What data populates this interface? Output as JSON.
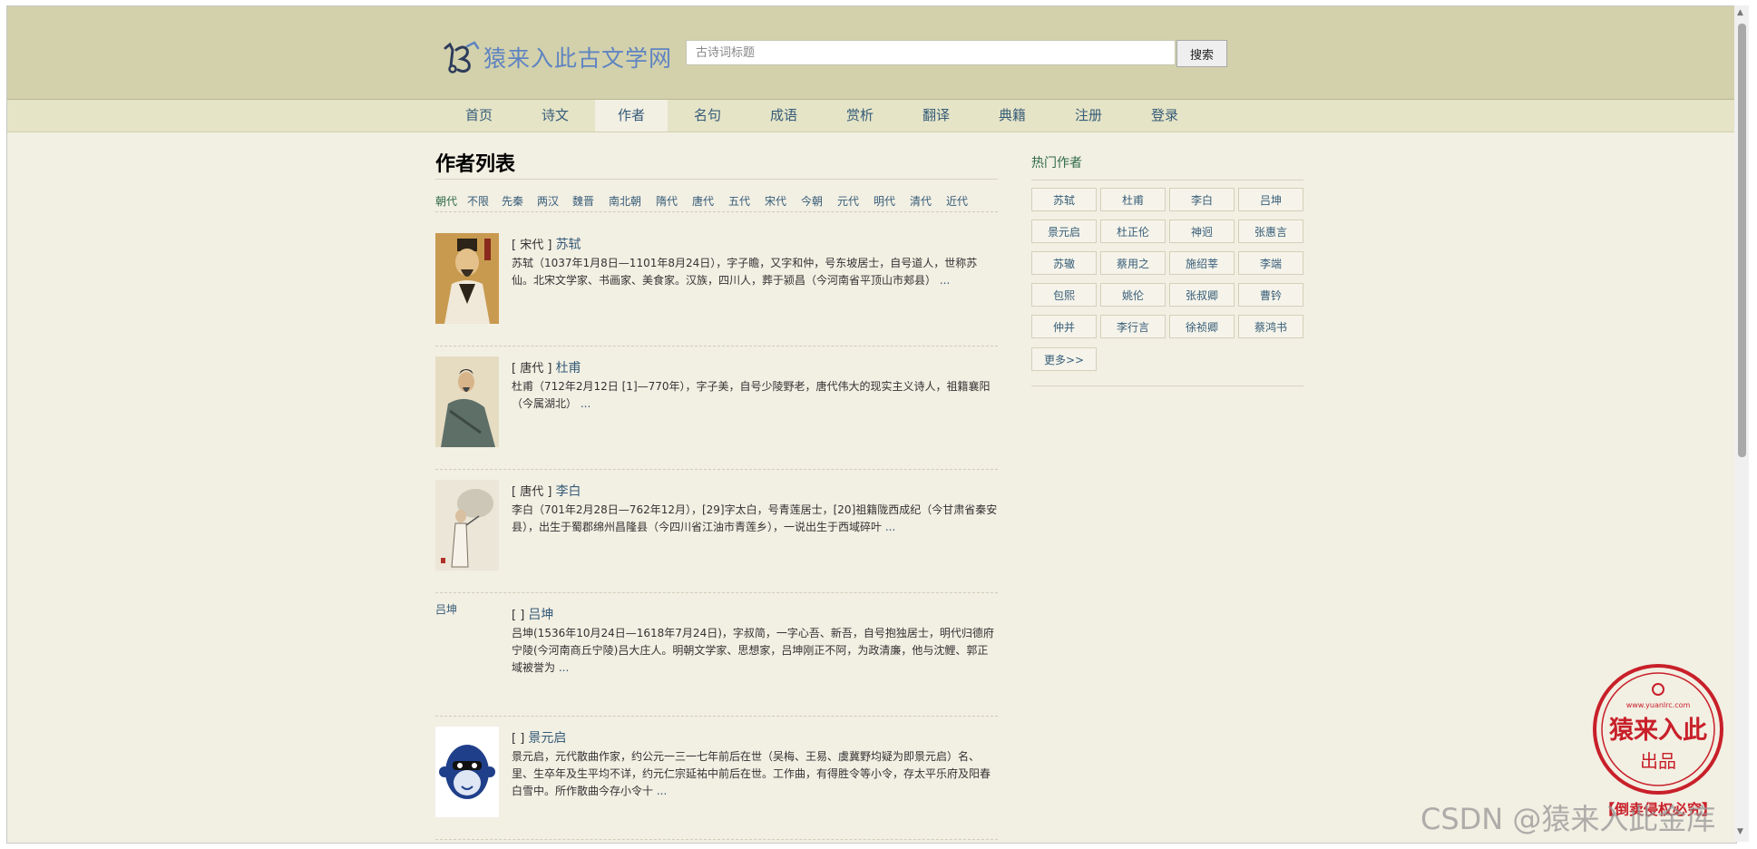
{
  "site": {
    "logo_text": "猿来入此古文学网"
  },
  "search": {
    "placeholder": "古诗词标题",
    "button": "搜索"
  },
  "nav": [
    "首页",
    "诗文",
    "作者",
    "名句",
    "成语",
    "赏析",
    "翻译",
    "典籍",
    "注册",
    "登录"
  ],
  "nav_active": 2,
  "page_title": "作者列表",
  "dynasties": [
    "朝代",
    "不限",
    "先秦",
    "两汉",
    "魏晋",
    "南北朝",
    "隋代",
    "唐代",
    "五代",
    "宋代",
    "今朝",
    "元代",
    "明代",
    "清代",
    "近代"
  ],
  "authors": [
    {
      "dynasty": "[ 宋代 ]",
      "name": "苏轼",
      "bio": "苏轼（1037年1月8日—1101年8月24日），字子瞻，又字和仲，号东坡居士，自号道人，世称苏仙。北宋文学家、书画家、美食家。汉族，四川人，葬于颍昌（今河南省平顶山市郏县）",
      "more": "..."
    },
    {
      "dynasty": "[ 唐代 ]",
      "name": "杜甫",
      "bio": "杜甫（712年2月12日 [1]—770年），字子美，自号少陵野老，唐代伟大的现实主义诗人，祖籍襄阳（今属湖北）",
      "more": "..."
    },
    {
      "dynasty": "[ 唐代 ]",
      "name": "李白",
      "bio": "李白（701年2月28日—762年12月），[29]字太白，号青莲居士，[20]祖籍陇西成纪（今甘肃省秦安县），出生于蜀郡绵州昌隆县（今四川省江油市青莲乡），一说出生于西域碎叶",
      "more": "..."
    },
    {
      "dynasty": "[ ]",
      "name": "吕坤",
      "img_alt": "吕坤",
      "bio": "吕坤(1536年10月24日—1618年7月24日)，字叔简，一字心吾、新吾，自号抱独居士，明代归德府宁陵(今河南商丘宁陵)吕大庄人。明朝文学家、思想家，吕坤刚正不阿，为政清廉，他与沈鲤、郭正域被誉为",
      "more": "..."
    },
    {
      "dynasty": "[ ]",
      "name": "景元启",
      "bio": "景元启，元代散曲作家，约公元一三一七年前后在世（吴梅、王易、虞冀野均疑为即景元启）名、里、生卒年及生平均不详，约元仁宗延祐中前后在世。工作曲，有得胜令等小令，存太平乐府及阳春白雪中。所作散曲今存小令十",
      "more": "..."
    }
  ],
  "hot": {
    "title": "热门作者",
    "items": [
      "苏轼",
      "杜甫",
      "李白",
      "吕坤",
      "景元启",
      "杜正伦",
      "神迥",
      "张惠言",
      "苏辙",
      "蔡用之",
      "施绍莘",
      "李端",
      "包熙",
      "姚伦",
      "张叔卿",
      "曹钤",
      "仲并",
      "李行言",
      "徐祯卿",
      "蔡鸿书"
    ],
    "more": "更多>>"
  },
  "stamp": {
    "line1": "猿来入此",
    "line2": "出品",
    "url": "www.yuanlrc.com",
    "footer": "【倒卖侵权必究】"
  },
  "watermark": "CSDN @猿来入此金库",
  "colors": {
    "header_bg": "#d3d1ab",
    "nav_bg": "#e5e4c7",
    "page_bg": "#f2efe3",
    "link": "#365c78",
    "logo": "#5f84c2",
    "stamp": "#c8202a"
  }
}
